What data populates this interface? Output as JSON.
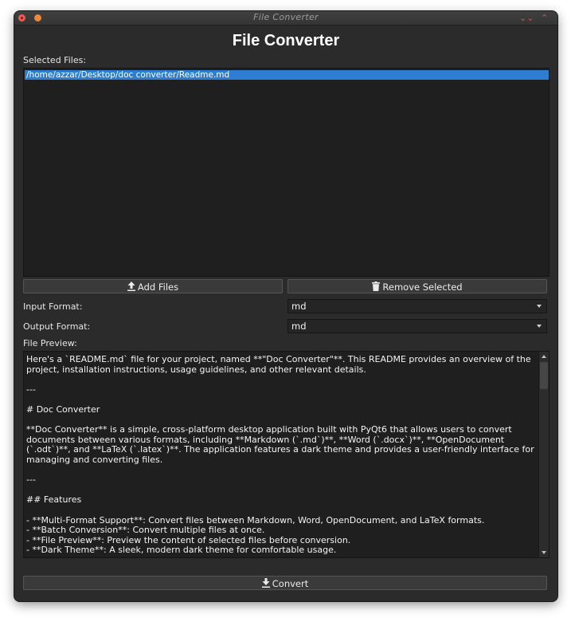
{
  "window": {
    "title": "File Converter"
  },
  "header": {
    "title": "File Converter"
  },
  "files": {
    "label": "Selected Files:",
    "items": [
      "/home/azzar/Desktop/doc converter/Readme.md"
    ]
  },
  "buttons": {
    "add": "Add Files",
    "remove": "Remove Selected",
    "convert": "Convert"
  },
  "formats": {
    "input_label": "Input Format:",
    "input_value": "md",
    "output_label": "Output Format:",
    "output_value": "md"
  },
  "preview": {
    "label": "File Preview:",
    "text": "Here's a `README.md` file for your project, named **\"Doc Converter\"**. This README provides an overview of the\nproject, installation instructions, usage guidelines, and other relevant details.\n\n---\n\n# Doc Converter\n\n**Doc Converter** is a simple, cross-platform desktop application built with PyQt6 that allows users to convert\ndocuments between various formats, including **Markdown (`.md`)**, **Word (`.docx`)**, **OpenDocument\n(`.odt`)**, and **LaTeX (`.latex`)**. The application features a dark theme and provides a user-friendly interface for\nmanaging and converting files.\n\n---\n\n## Features\n\n- **Multi-Format Support**: Convert files between Markdown, Word, OpenDocument, and LaTeX formats.\n- **Batch Conversion**: Convert multiple files at once.\n- **File Preview**: Preview the content of selected files before conversion.\n- **Dark Theme**: A sleek, modern dark theme for comfortable usage."
  },
  "icons": {
    "add": "upload-icon",
    "remove": "trash-icon",
    "convert": "download-icon"
  },
  "colors": {
    "selection": "#2d7dd2",
    "window_bg": "#2b2b2b"
  }
}
